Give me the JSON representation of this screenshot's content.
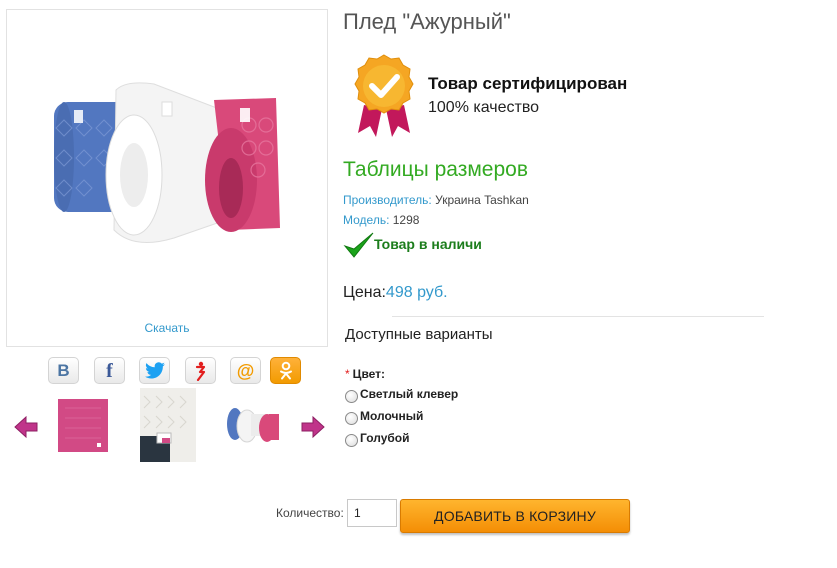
{
  "product": {
    "title": "Плед \"Ажурный\"",
    "download_label": "Скачать",
    "certified_title": "Товар сертифицирован",
    "certified_sub": "100% качество",
    "size_table_label": "Таблицы размеров",
    "manufacturer_label": "Производитель:",
    "manufacturer_value": "Украина Tashkan",
    "model_label": "Модель:",
    "model_value": "1298",
    "stock_status": "Товар в наличи",
    "price_label": "Цена:",
    "price_value": "498 руб."
  },
  "share": {
    "vk": {
      "icon": "vk-icon",
      "glyph": "В",
      "color": "#4c75a3"
    },
    "facebook": {
      "icon": "facebook-icon",
      "glyph": "f",
      "color": "#3b5998"
    },
    "twitter": {
      "icon": "twitter-icon",
      "color": "#1da1f2"
    },
    "yandex": {
      "icon": "yandex-icon",
      "color": "#e21e1e"
    },
    "mail": {
      "icon": "mail-at-icon",
      "glyph": "@",
      "color": "#f29b00"
    },
    "odnoklassniki": {
      "icon": "odnoklassniki-icon",
      "color": "#f29b00"
    }
  },
  "thumbnails": [
    "thumb-pink-blanket",
    "thumb-white-blanket-with-label",
    "thumb-three-rolled-blankets"
  ],
  "variants": {
    "heading": "Доступные варианты",
    "required_mark": "*",
    "color_label": "Цвет:",
    "options": [
      "Светлый клевер",
      "Молочный",
      "Голубой"
    ],
    "selected": null
  },
  "cart": {
    "quantity_label": "Количество:",
    "quantity_value": "1",
    "add_button": "ДОБАВИТЬ В КОРЗИНУ"
  },
  "colors": {
    "link_blue": "#3399cc",
    "green": "#33aa22",
    "stock_green": "#1c7d1c",
    "cart_orange": "#f48e05",
    "arrow_magenta": "#c0348a"
  }
}
